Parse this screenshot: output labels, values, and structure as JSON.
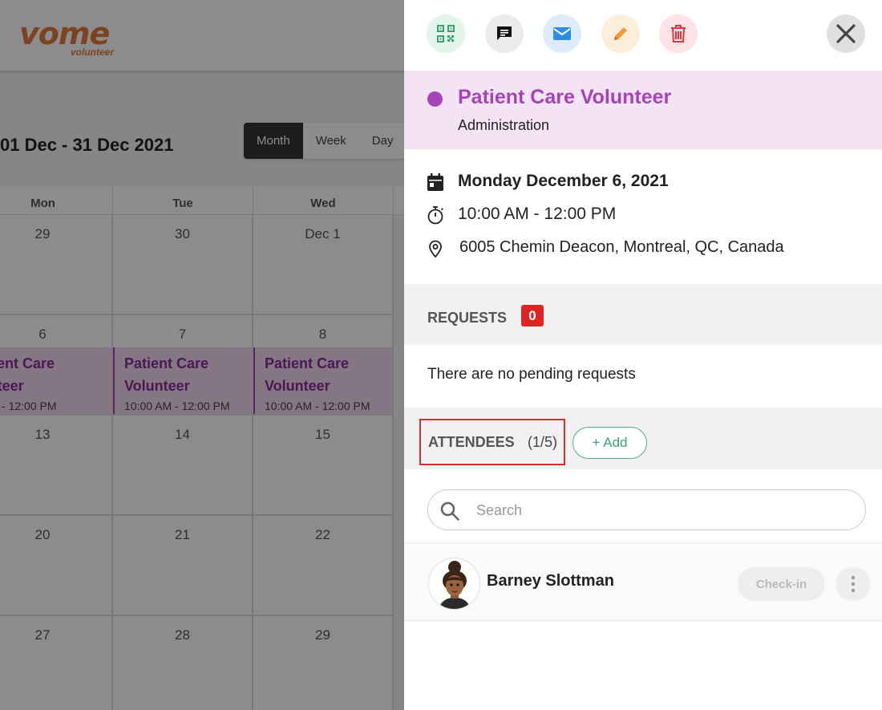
{
  "app": {
    "logo_main": "vome",
    "logo_sub": "volunteer"
  },
  "calendar": {
    "range": "01 Dec - 31 Dec 2021",
    "views": [
      "Month",
      "Week",
      "Day"
    ],
    "active_view": "Month",
    "weekdays": [
      "Mon",
      "Tue",
      "Wed"
    ],
    "weeks": [
      [
        "29",
        "30",
        "Dec 1"
      ],
      [
        "6",
        "7",
        "8"
      ],
      [
        "13",
        "14",
        "15"
      ],
      [
        "20",
        "21",
        "22"
      ],
      [
        "27",
        "28",
        "29"
      ]
    ],
    "event_title_line1": "Patient Care",
    "event_title_line2": "Volunteer",
    "event_time": "10:00 AM - 12:00 PM"
  },
  "colors": {
    "accent": "#a543b8",
    "event_bg": "#f1d9ef",
    "badge": "#e02424",
    "add_green": "#3ba26f"
  },
  "panel": {
    "actions": [
      {
        "name": "qr-code-icon"
      },
      {
        "name": "chat-icon"
      },
      {
        "name": "mail-icon"
      },
      {
        "name": "edit-icon"
      },
      {
        "name": "trash-icon"
      }
    ],
    "title": "Patient Care Volunteer",
    "category": "Administration",
    "date": "Monday December 6, 2021",
    "time": "10:00 AM -  12:00 PM",
    "location": "6005 Chemin Deacon, Montreal, QC, Canada",
    "requests": {
      "label": "REQUESTS",
      "count": "0",
      "empty_text": "There are no pending requests"
    },
    "attendees": {
      "label": "ATTENDEES",
      "count": "(1/5)",
      "add_label": "+ Add",
      "search_placeholder": "Search",
      "list": [
        {
          "name": "Barney Slottman",
          "checkin_label": "Check-in"
        }
      ]
    }
  }
}
